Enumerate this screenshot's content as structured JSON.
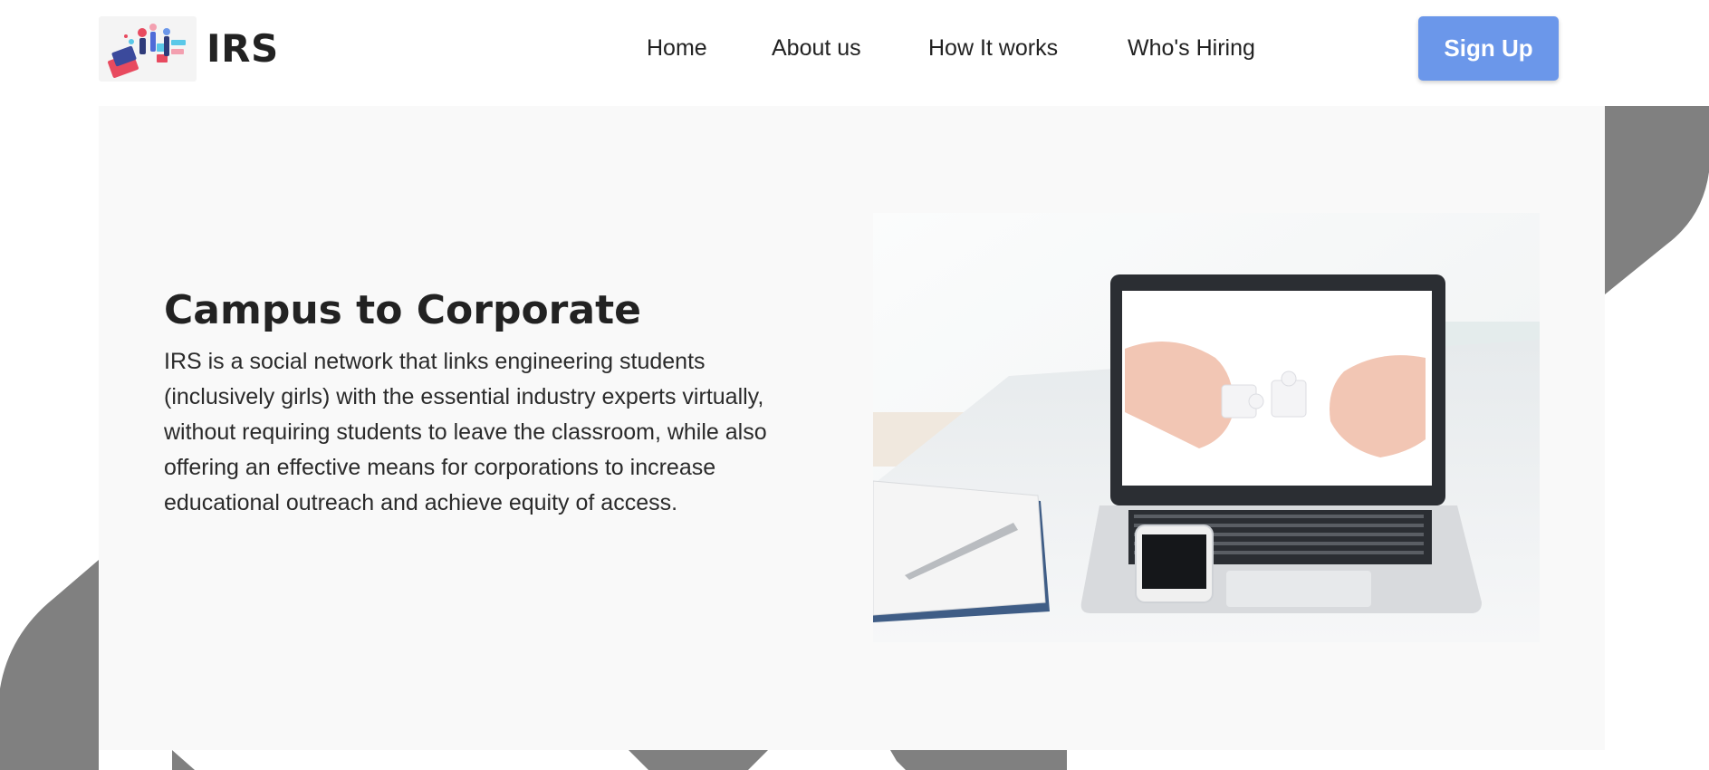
{
  "header": {
    "brand": "IRS",
    "nav": [
      {
        "label": "Home"
      },
      {
        "label": "About us"
      },
      {
        "label": "How It works"
      },
      {
        "label": "Who's Hiring"
      }
    ],
    "signup_label": "Sign Up"
  },
  "hero": {
    "title": "Campus to Corporate",
    "description": "IRS is a social network that links engineering students (inclusively girls) with the essential industry experts virtually, without requiring students to leave the classroom, while also offering an effective means for corporations to increase educational outreach and achieve equity of access."
  },
  "colors": {
    "accent": "#6b97ea",
    "decor": "#808080",
    "panel": "#f9f9f9",
    "text": "#222222"
  }
}
